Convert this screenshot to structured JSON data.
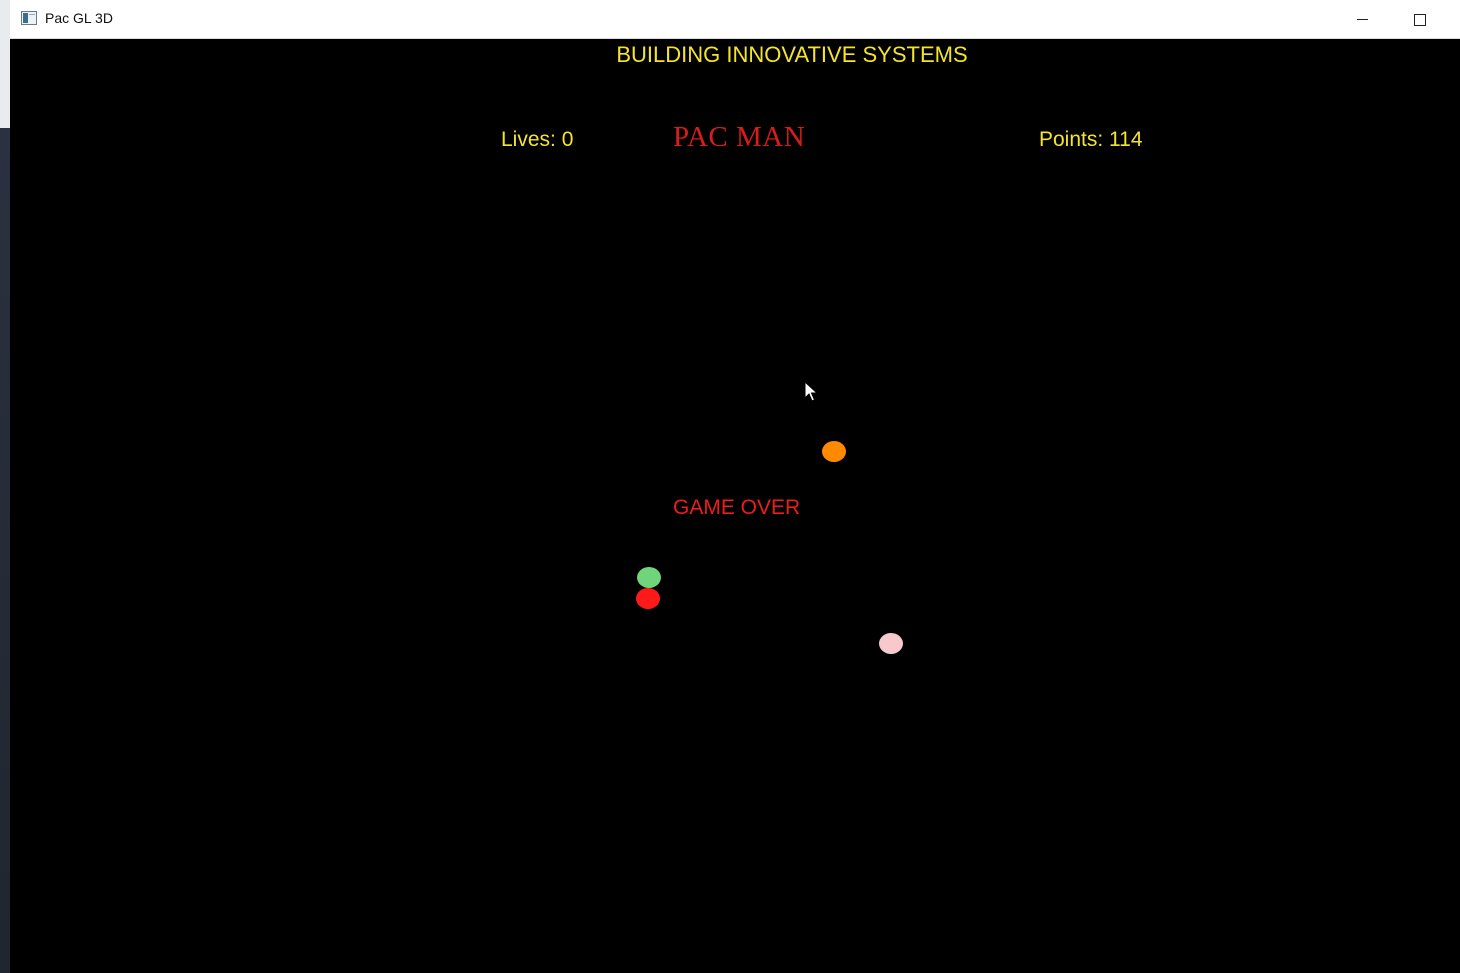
{
  "window": {
    "title": "Pac GL 3D",
    "icon": "app-window-icon",
    "controls": [
      "minimize-icon",
      "maximize-icon"
    ]
  },
  "hud": {
    "banner": "BUILDING INNOVATIVE SYSTEMS",
    "lives": "Lives: 0",
    "title": "PAC MAN",
    "points": "Points: 114"
  },
  "status": {
    "message": "GAME OVER"
  },
  "ghosts": [
    {
      "name": "orange-ghost",
      "color": "#ff8a00"
    },
    {
      "name": "green-ghost",
      "color": "#6fd47a"
    },
    {
      "name": "red-ghost",
      "color": "#ff1a1a"
    },
    {
      "name": "pink-ghost",
      "color": "#f7c9cc"
    }
  ],
  "colors": {
    "hud_text": "#f5e52a",
    "title_red": "#d81c1c",
    "game_over_red": "#ee1c1c",
    "background": "#000000"
  }
}
